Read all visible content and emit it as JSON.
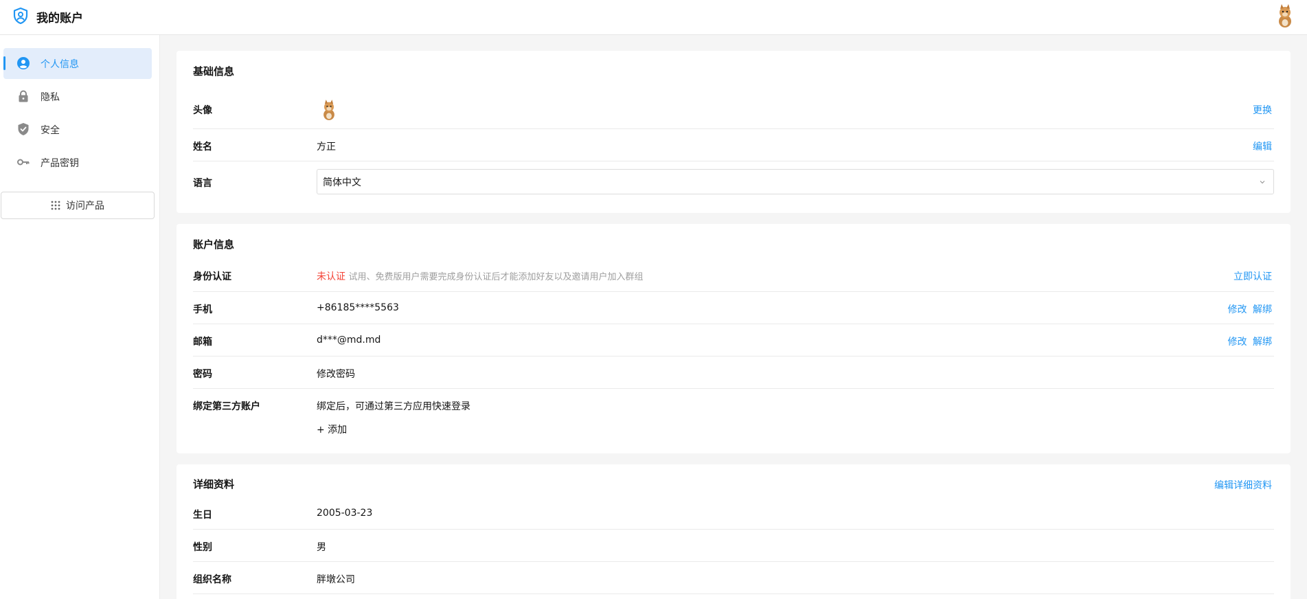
{
  "header": {
    "title": "我的账户",
    "logo_icon": "shield-user-icon",
    "avatar_icon": "cat-avatar"
  },
  "sidebar": {
    "items": [
      {
        "label": "个人信息",
        "icon": "user-circle-icon",
        "active": true
      },
      {
        "label": "隐私",
        "icon": "lock-icon",
        "active": false
      },
      {
        "label": "安全",
        "icon": "shield-check-icon",
        "active": false
      },
      {
        "label": "产品密钥",
        "icon": "key-icon",
        "active": false
      }
    ],
    "visit_button": "访问产品"
  },
  "basic": {
    "title": "基础信息",
    "avatar_label": "头像",
    "avatar_action": "更换",
    "name_label": "姓名",
    "name_value": "方正",
    "name_action": "编辑",
    "language_label": "语言",
    "language_value": "简体中文"
  },
  "account": {
    "title": "账户信息",
    "identity_label": "身份认证",
    "identity_status": "未认证",
    "identity_desc": "试用、免费版用户需要完成身份认证后才能添加好友以及邀请用户加入群组",
    "identity_action": "立即认证",
    "phone_label": "手机",
    "phone_value": "+86185****5563",
    "email_label": "邮箱",
    "email_value": "d***@md.md",
    "modify": "修改",
    "unbind": "解绑",
    "password_label": "密码",
    "password_action": "修改密码",
    "third_label": "绑定第三方账户",
    "third_desc": "绑定后，可通过第三方应用快速登录",
    "third_add": "+ 添加"
  },
  "detail": {
    "title": "详细资料",
    "edit_action": "编辑详细资料",
    "birthday_label": "生日",
    "birthday_value": "2005-03-23",
    "gender_label": "性别",
    "gender_value": "男",
    "org_label": "组织名称",
    "org_value": "胖墩公司"
  },
  "colors": {
    "accent": "#2196f3",
    "danger": "#f44336",
    "active_bg": "#e3edfb"
  }
}
